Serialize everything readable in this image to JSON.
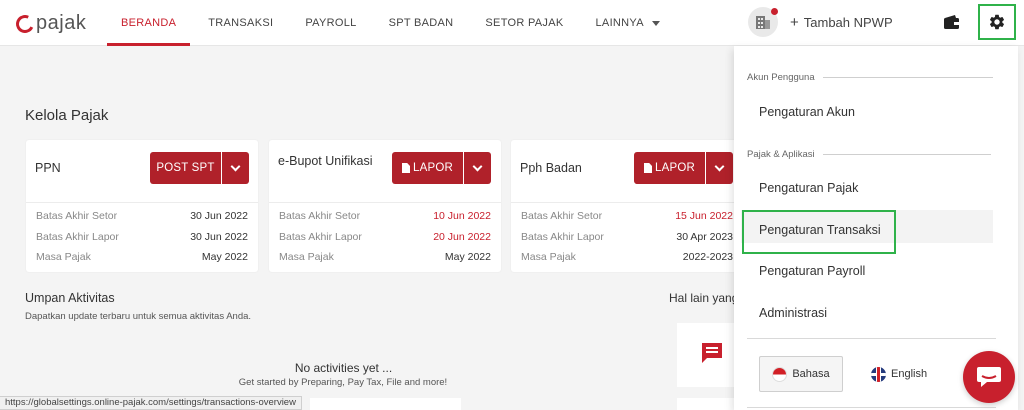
{
  "brand": {
    "logo_text": "pajak",
    "accent": "#c8202d",
    "button": "#b0212a",
    "highlight_outline": "#2fb24a"
  },
  "nav": {
    "items": [
      {
        "label": "BERANDA",
        "active": true
      },
      {
        "label": "TRANSAKSI"
      },
      {
        "label": "PAYROLL"
      },
      {
        "label": "SPT BADAN"
      },
      {
        "label": "SETOR PAJAK"
      },
      {
        "label": "LAINNYA"
      }
    ],
    "add_npwp": "Tambah NPWP",
    "icons": [
      "building-icon",
      "wallet-icon",
      "gear-icon"
    ]
  },
  "main": {
    "section_title": "Kelola Pajak",
    "cards": [
      {
        "name": "PPN",
        "button": "POST SPT",
        "rows": [
          {
            "label": "Batas Akhir Setor",
            "value": "30 Jun 2022"
          },
          {
            "label": "Batas Akhir Lapor",
            "value": "30 Jun 2022"
          },
          {
            "label": "Masa Pajak",
            "value": "May 2022"
          }
        ]
      },
      {
        "name": "e-Bupot Unifikasi",
        "button": "LAPOR",
        "rows": [
          {
            "label": "Batas Akhir Setor",
            "value": "10 Jun 2022",
            "status": "overdue"
          },
          {
            "label": "Batas Akhir Lapor",
            "value": "20 Jun 2022",
            "status": "overdue"
          },
          {
            "label": "Masa Pajak",
            "value": "May 2022"
          }
        ]
      },
      {
        "name": "Pph Badan",
        "button": "LAPOR",
        "rows": [
          {
            "label": "Batas Akhir Setor",
            "value": "15 Jun 2022",
            "status": "overdue"
          },
          {
            "label": "Batas Akhir Lapor",
            "value": "30 Apr 2023"
          },
          {
            "label": "Masa Pajak",
            "value": "2022-2023"
          }
        ]
      }
    ],
    "activity": {
      "title": "Umpan Aktivitas",
      "subtitle": "Dapatkan update terbaru untuk semua aktivitas Anda.",
      "empty_title": "No activities yet ...",
      "empty_sub": "Get started by Preparing, Pay Tax, File and more!"
    },
    "other_title": "Hal lain yang"
  },
  "dropdown": {
    "group_account": "Akun Pengguna",
    "item_account": "Pengaturan Akun",
    "group_tax": "Pajak & Aplikasi",
    "items_tax": [
      "Pengaturan Pajak",
      "Pengaturan Transaksi",
      "Pengaturan Payroll",
      "Administrasi"
    ],
    "lang_id": "Bahasa",
    "lang_en": "English"
  },
  "status_url": "https://globalsettings.online-pajak.com/settings/transactions-overview"
}
